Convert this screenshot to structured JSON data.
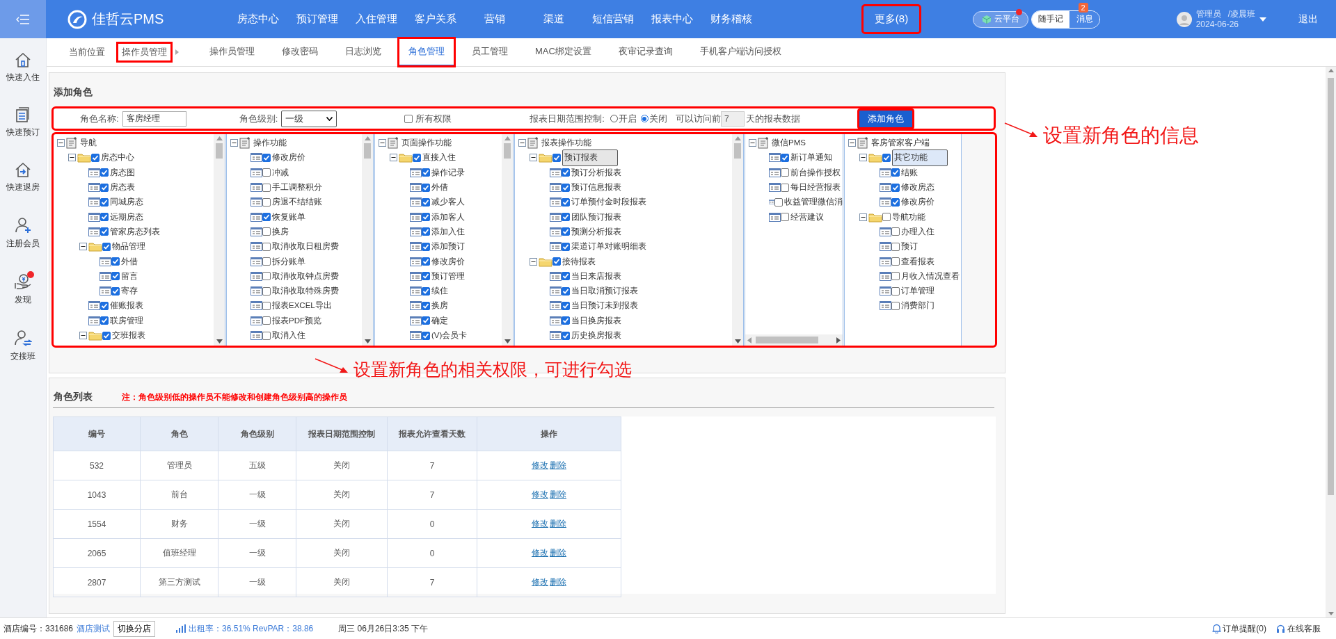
{
  "header": {
    "logo": "佳哲云PMS",
    "nav": [
      {
        "label": "房态中心",
        "highlighted": false
      },
      {
        "label": "预订管理",
        "highlighted": false
      },
      {
        "label": "入住管理",
        "highlighted": false
      },
      {
        "label": "客户关系",
        "highlighted": false
      },
      {
        "label": "营销",
        "highlighted": false
      },
      {
        "label": "渠道",
        "highlighted": false
      },
      {
        "label": "短信营销",
        "highlighted": false
      },
      {
        "label": "报表中心",
        "highlighted": false
      },
      {
        "label": "财务稽核",
        "highlighted": false
      },
      {
        "label": "更多(8)",
        "highlighted": true
      }
    ],
    "cloud": {
      "label": "云平台",
      "notification": true
    },
    "notes": "随手记",
    "messages": {
      "label": "消息",
      "badge": "2"
    },
    "user": {
      "name": "管理员",
      "shift": "/凌晨班",
      "date": "2024-06-26"
    },
    "logout": "退出"
  },
  "sidebar": [
    {
      "label": "快速入住",
      "notification": false
    },
    {
      "label": "快速预订",
      "notification": false
    },
    {
      "label": "快速退房",
      "notification": false
    },
    {
      "label": "注册会员",
      "notification": false
    },
    {
      "label": "发现",
      "notification": true
    },
    {
      "label": "交接班",
      "notification": false
    }
  ],
  "breadcrumb": {
    "label": "当前位置",
    "current": {
      "label": "操作员管理",
      "highlighted": true
    }
  },
  "tabs": [
    {
      "label": "操作员管理",
      "selected": false,
      "highlighted": false
    },
    {
      "label": "修改密码",
      "selected": false,
      "highlighted": false
    },
    {
      "label": "日志浏览",
      "selected": false,
      "highlighted": false
    },
    {
      "label": "角色管理",
      "selected": true,
      "highlighted": true
    },
    {
      "label": "员工管理",
      "selected": false,
      "highlighted": false
    },
    {
      "label": "MAC绑定设置",
      "selected": false,
      "highlighted": false
    },
    {
      "label": "夜审记录查询",
      "selected": false,
      "highlighted": false
    },
    {
      "label": "手机客户端访问授权",
      "selected": false,
      "highlighted": false
    }
  ],
  "add_role": {
    "title": "添加角色",
    "form": {
      "highlighted": true,
      "name_label": "角色名称:",
      "name_value": "客房经理",
      "level_label": "角色级别:",
      "level_value": "一级",
      "all_permissions": {
        "label": "所有权限",
        "checked": false
      },
      "date_control_label": "报表日期范围控制:",
      "date_control_options": [
        {
          "label": "开启",
          "selected": false
        },
        {
          "label": "关闭",
          "selected": true
        }
      ],
      "access_prefix": "可以访问前",
      "access_days": "7",
      "access_suffix": "天的报表数据",
      "submit": {
        "label": "添加角色",
        "highlighted": true
      }
    },
    "permissions": {
      "highlighted": true,
      "panels": [
        {
          "tree": {
            "label": "导航",
            "kind": "root",
            "expanded": true,
            "children": [
              {
                "label": "房态中心",
                "kind": "folder",
                "expanded": true,
                "checked": true,
                "children": [
                  {
                    "label": "房态图",
                    "kind": "leaf",
                    "checked": true
                  },
                  {
                    "label": "房态表",
                    "kind": "leaf",
                    "checked": true
                  },
                  {
                    "label": "同城房态",
                    "kind": "leaf",
                    "checked": true
                  },
                  {
                    "label": "远期房态",
                    "kind": "leaf",
                    "checked": true
                  },
                  {
                    "label": "管家房态列表",
                    "kind": "leaf",
                    "checked": true
                  },
                  {
                    "label": "物品管理",
                    "kind": "folder",
                    "expanded": true,
                    "checked": true,
                    "children": [
                      {
                        "label": "外借",
                        "kind": "leaf",
                        "checked": true
                      },
                      {
                        "label": "留言",
                        "kind": "leaf",
                        "checked": true
                      },
                      {
                        "label": "寄存",
                        "kind": "leaf",
                        "checked": true
                      }
                    ]
                  },
                  {
                    "label": "催账报表",
                    "kind": "leaf",
                    "checked": true
                  },
                  {
                    "label": "联房管理",
                    "kind": "leaf",
                    "checked": true
                  },
                  {
                    "label": "交班报表",
                    "kind": "folder",
                    "expanded": true,
                    "checked": true
                  }
                ]
              }
            ]
          }
        },
        {
          "tree": {
            "label": "操作功能",
            "kind": "root",
            "expanded": true,
            "children": [
              {
                "label": "修改房价",
                "kind": "leaf",
                "checked": true
              },
              {
                "label": "冲减",
                "kind": "leaf",
                "checked": false
              },
              {
                "label": "手工调整积分",
                "kind": "leaf",
                "checked": false
              },
              {
                "label": "房退不结结账",
                "kind": "leaf",
                "checked": false
              },
              {
                "label": "恢复账单",
                "kind": "leaf",
                "checked": true
              },
              {
                "label": "换房",
                "kind": "leaf",
                "checked": false
              },
              {
                "label": "取消收取日租房费",
                "kind": "leaf",
                "checked": false
              },
              {
                "label": "拆分账单",
                "kind": "leaf",
                "checked": false
              },
              {
                "label": "取消收取钟点房费",
                "kind": "leaf",
                "checked": false
              },
              {
                "label": "取消收取特殊房费",
                "kind": "leaf",
                "checked": false
              },
              {
                "label": "报表EXCEL导出",
                "kind": "leaf",
                "checked": false
              },
              {
                "label": "报表PDF预览",
                "kind": "leaf",
                "checked": false
              },
              {
                "label": "取消入住",
                "kind": "leaf",
                "checked": false
              }
            ]
          }
        },
        {
          "tree": {
            "label": "页面操作功能",
            "kind": "root",
            "expanded": true,
            "children": [
              {
                "label": "直接入住",
                "kind": "folder",
                "expanded": true,
                "checked": true,
                "children": [
                  {
                    "label": "操作记录",
                    "kind": "leaf",
                    "checked": true
                  },
                  {
                    "label": "外借",
                    "kind": "leaf",
                    "checked": true
                  },
                  {
                    "label": "减少客人",
                    "kind": "leaf",
                    "checked": true
                  },
                  {
                    "label": "添加客人",
                    "kind": "leaf",
                    "checked": true
                  },
                  {
                    "label": "添加入住",
                    "kind": "leaf",
                    "checked": true
                  },
                  {
                    "label": "添加预订",
                    "kind": "leaf",
                    "checked": true
                  },
                  {
                    "label": "修改房价",
                    "kind": "leaf",
                    "checked": true
                  },
                  {
                    "label": "预订管理",
                    "kind": "leaf",
                    "checked": true
                  },
                  {
                    "label": "续住",
                    "kind": "leaf",
                    "checked": true
                  },
                  {
                    "label": "换房",
                    "kind": "leaf",
                    "checked": true
                  },
                  {
                    "label": "确定",
                    "kind": "leaf",
                    "checked": true
                  },
                  {
                    "label": "(V)会员卡",
                    "kind": "leaf",
                    "checked": true
                  }
                ]
              }
            ]
          }
        },
        {
          "tree": {
            "label": "报表操作功能",
            "kind": "root",
            "expanded": true,
            "children": [
              {
                "label": "预订报表",
                "kind": "folder",
                "expanded": true,
                "checked": true,
                "selected": true,
                "children": [
                  {
                    "label": "预订分析报表",
                    "kind": "leaf",
                    "checked": true
                  },
                  {
                    "label": "预订信息报表",
                    "kind": "leaf",
                    "checked": true
                  },
                  {
                    "label": "订单预付金时段报表",
                    "kind": "leaf",
                    "checked": true
                  },
                  {
                    "label": "团队预订报表",
                    "kind": "leaf",
                    "checked": true
                  },
                  {
                    "label": "预测分析报表",
                    "kind": "leaf",
                    "checked": true
                  },
                  {
                    "label": "渠道订单对账明细表",
                    "kind": "leaf",
                    "checked": true
                  }
                ]
              },
              {
                "label": "接待报表",
                "kind": "folder",
                "expanded": true,
                "checked": true,
                "children": [
                  {
                    "label": "当日来店报表",
                    "kind": "leaf",
                    "checked": true
                  },
                  {
                    "label": "当日取消预订报表",
                    "kind": "leaf",
                    "checked": true
                  },
                  {
                    "label": "当日预订未到报表",
                    "kind": "leaf",
                    "checked": true
                  },
                  {
                    "label": "当日换房报表",
                    "kind": "leaf",
                    "checked": true
                  },
                  {
                    "label": "历史换房报表",
                    "kind": "leaf",
                    "checked": true
                  }
                ]
              }
            ]
          }
        },
        {
          "tree": {
            "label": "微信PMS",
            "kind": "root",
            "expanded": true,
            "children": [
              {
                "label": "新订单通知",
                "kind": "leaf",
                "checked": true
              },
              {
                "label": "前台操作授权",
                "kind": "leaf",
                "checked": false
              },
              {
                "label": "每日经营报表",
                "kind": "leaf",
                "checked": false
              },
              {
                "label": "收益管理微信消",
                "kind": "leaf",
                "checked": false
              },
              {
                "label": "经营建议",
                "kind": "leaf",
                "checked": false
              }
            ]
          }
        },
        {
          "tree": {
            "label": "客房管家客户端",
            "kind": "root",
            "expanded": true,
            "children": [
              {
                "label": "其它功能",
                "kind": "folder",
                "expanded": true,
                "checked": true,
                "selected": true,
                "children": [
                  {
                    "label": "结账",
                    "kind": "leaf",
                    "checked": true
                  },
                  {
                    "label": "修改房态",
                    "kind": "leaf",
                    "checked": true
                  },
                  {
                    "label": "修改房价",
                    "kind": "leaf",
                    "checked": true
                  }
                ]
              },
              {
                "label": "导航功能",
                "kind": "folder",
                "expanded": true,
                "checked": false,
                "children": [
                  {
                    "label": "办理入住",
                    "kind": "leaf",
                    "checked": false
                  },
                  {
                    "label": "预订",
                    "kind": "leaf",
                    "checked": false
                  },
                  {
                    "label": "查看报表",
                    "kind": "leaf",
                    "checked": false
                  },
                  {
                    "label": "月收入情况查看",
                    "kind": "leaf",
                    "checked": false
                  },
                  {
                    "label": "订单管理",
                    "kind": "leaf",
                    "checked": false
                  },
                  {
                    "label": "消费部门",
                    "kind": "leaf",
                    "checked": false
                  }
                ]
              }
            ]
          }
        }
      ]
    }
  },
  "callouts": [
    {
      "text": "设置新角色的信息"
    },
    {
      "text": "设置新角色的相关权限，可进行勾选"
    }
  ],
  "role_list": {
    "title": "角色列表",
    "note": "注：角色级别低的操作员不能修改和创建角色级别高的操作员",
    "columns": [
      "编号",
      "角色",
      "角色级别",
      "报表日期范围控制",
      "报表允许查看天数",
      "操作"
    ],
    "rows": [
      {
        "cells": [
          "532",
          "管理员",
          "五级",
          "关闭",
          "7"
        ],
        "actions": [
          "修改",
          "删除"
        ]
      },
      {
        "cells": [
          "1043",
          "前台",
          "一级",
          "关闭",
          "7"
        ],
        "actions": [
          "修改",
          "删除"
        ]
      },
      {
        "cells": [
          "1554",
          "财务",
          "一级",
          "关闭",
          "0"
        ],
        "actions": [
          "修改",
          "删除"
        ]
      },
      {
        "cells": [
          "2065",
          "值班经理",
          "一级",
          "关闭",
          "0"
        ],
        "actions": [
          "修改",
          "删除"
        ]
      },
      {
        "cells": [
          "2807",
          "第三方测试",
          "一级",
          "关闭",
          "7"
        ],
        "actions": [
          "修改",
          "删除"
        ]
      }
    ]
  },
  "status_bar": {
    "hotel_number": "酒店编号：331686",
    "hotel_name": "酒店测试",
    "switch": "切换分店",
    "occupancy": "出租率：36.51% RevPAR：38.86",
    "datetime": "周三 06月26日3:35 下午",
    "order_alert": "订单提醒(0)",
    "support": "在线客服"
  }
}
